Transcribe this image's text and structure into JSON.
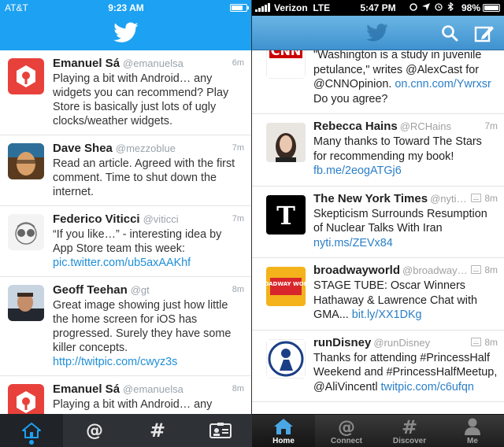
{
  "left": {
    "status": {
      "carrier": "AT&T",
      "time": "9:23 AM",
      "battery_level": 0.8
    },
    "tweets": [
      {
        "name": "Emanuel Sá",
        "handle": "@emanuelsa",
        "age": "6m",
        "text": "Playing a bit with Android… any widgets you can recommend? Play Store is basically just lots of ugly clocks/weather widgets.",
        "link": ""
      },
      {
        "name": "Dave Shea",
        "handle": "@mezzoblue",
        "age": "7m",
        "text": "Read an article. Agreed with the first comment. Time to shut down the internet.",
        "link": ""
      },
      {
        "name": "Federico Viticci",
        "handle": "@viticci",
        "age": "7m",
        "text": "“If you like…” - interesting idea by App Store team this week: ",
        "link": "pic.twitter.com/ub5axAAKhf"
      },
      {
        "name": "Geoff Teehan",
        "handle": "@gt",
        "age": "8m",
        "text": "Great image showing just how little the home screen for iOS has progressed. Surely they have some killer concepts. ",
        "link": "http://twitpic.com/cwyz3s"
      },
      {
        "name": "Emanuel Sá",
        "handle": "@emanuelsa",
        "age": "8m",
        "text": "Playing a bit with Android… any",
        "link": ""
      }
    ],
    "tabs": [
      "home-tab",
      "connect-tab",
      "discover-tab",
      "me-tab"
    ]
  },
  "right": {
    "status": {
      "carrier": "Verizon",
      "network": "LTE",
      "time": "5:47 PM",
      "battery": "98%"
    },
    "tweets": [
      {
        "name": "",
        "handle": "",
        "age": "",
        "text": "\"Washington is a study in juvenile petulance,\" writes @AlexCast for @CNNOpinion. ",
        "link": "on.cnn.com/Ywrxsr",
        "text_after": " Do you agree?",
        "avatar_label": "CNN"
      },
      {
        "name": "Rebecca Hains",
        "handle": "@RCHains",
        "age": "7m",
        "text": "Many thanks to Toward The Stars for recommending my book! ",
        "link": "fb.me/2eogATGj6",
        "text_after": ""
      },
      {
        "name": "The New York Times",
        "handle": "@nyti…",
        "age": "8m",
        "text": "Skepticism Surrounds Resumption of Nuclear Talks With Iran ",
        "link": "nyti.ms/ZEVx84",
        "text_after": ""
      },
      {
        "name": "broadwayworld",
        "handle": "@broadway…",
        "age": "8m",
        "text": "STAGE TUBE: Oscar Winners Hathaway & Lawrence Chat with GMA... ",
        "link": "bit.ly/XX1DKg",
        "text_after": "",
        "avatar_label": "BROADWAY WORLD"
      },
      {
        "name": "runDisney",
        "handle": "@runDisney",
        "age": "8m",
        "text": "Thanks for attending #PrincessHalf Weekend and #PrincessHalfMeetup, @AliVincentl ",
        "link": "twitpic.com/c6ufqn",
        "text_after": ""
      }
    ],
    "tabs": [
      {
        "label": "Home"
      },
      {
        "label": "Connect"
      },
      {
        "label": "Discover"
      },
      {
        "label": "Me"
      }
    ]
  },
  "colors": {
    "twitter_blue": "#1da1f2",
    "link_blue": "#2a7fc7",
    "tabbar_dark": "#2e3237"
  }
}
